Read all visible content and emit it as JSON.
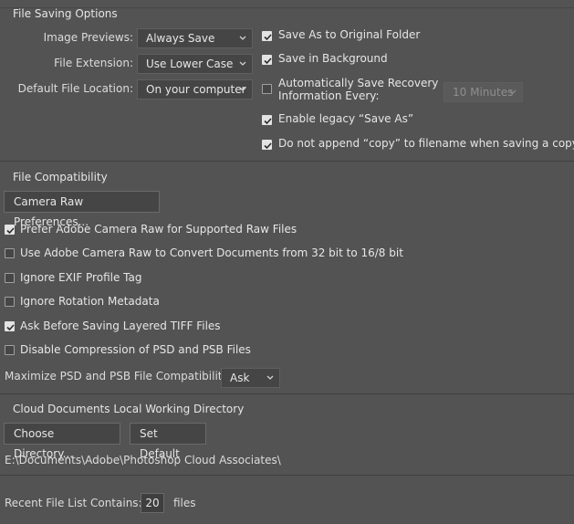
{
  "file_saving": {
    "title": "File Saving Options",
    "image_previews_label": "Image Previews:",
    "image_previews_value": "Always Save",
    "file_extension_label": "File Extension:",
    "file_extension_value": "Use Lower Case",
    "default_location_label": "Default File Location:",
    "default_location_value": "On your computer",
    "save_as_original": {
      "label": "Save As to Original Folder",
      "checked": true
    },
    "save_in_background": {
      "label": "Save in Background",
      "checked": true
    },
    "auto_recovery": {
      "label_line1": "Automatically Save Recovery",
      "label_line2": "Information Every:",
      "checked": false
    },
    "auto_recovery_interval": "10 Minutes",
    "legacy_save_as": {
      "label": "Enable legacy “Save As”",
      "checked": true
    },
    "no_copy_append": {
      "label": "Do not append “copy” to filename when saving a copy",
      "checked": true
    }
  },
  "file_compat": {
    "title": "File Compatibility",
    "camera_raw_button": "Camera Raw Preferences...",
    "options": [
      {
        "label": "Prefer Adobe Camera Raw for Supported Raw Files",
        "checked": true
      },
      {
        "label": "Use Adobe Camera Raw to Convert Documents from 32 bit to 16/8 bit",
        "checked": false
      },
      {
        "label": "Ignore EXIF Profile Tag",
        "checked": false
      },
      {
        "label": "Ignore Rotation Metadata",
        "checked": false
      },
      {
        "label": "Ask Before Saving Layered TIFF Files",
        "checked": true
      },
      {
        "label": "Disable Compression of PSD and PSB Files",
        "checked": false
      }
    ],
    "maximize_label": "Maximize PSD and PSB File Compatibility:",
    "maximize_value": "Ask"
  },
  "cloud": {
    "title": "Cloud Documents Local Working Directory",
    "choose_button": "Choose Directory...",
    "default_button": "Set Default",
    "path": "E:\\Documents\\Adobe\\Photoshop Cloud Associates\\"
  },
  "recent": {
    "label": "Recent File List Contains:",
    "value": "20",
    "suffix": "files"
  }
}
